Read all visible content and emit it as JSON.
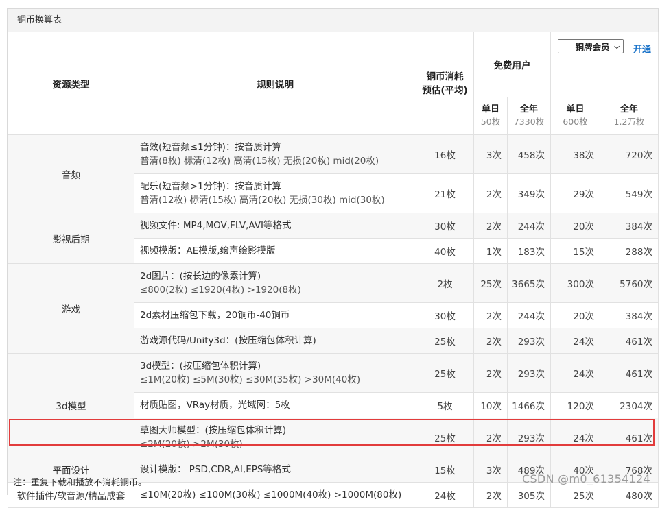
{
  "title": "铜币换算表",
  "header": {
    "resource_type": "资源类型",
    "rules": "规则说明",
    "cost_line1": "铜币消耗",
    "cost_line2": "预估(平均)",
    "free_user": "免费用户",
    "member_select": "铜牌会员",
    "open_link": "开通",
    "sub": [
      {
        "label": "单日",
        "value": "50枚"
      },
      {
        "label": "全年",
        "value": "7330枚"
      },
      {
        "label": "单日",
        "value": "600枚"
      },
      {
        "label": "全年",
        "value": "1.2万枚"
      }
    ]
  },
  "categories": {
    "audio": "音频",
    "video": "影视后期",
    "game": "游戏",
    "model3d": "3d模型",
    "graphic": "平面设计",
    "software": "软件插件/软音源/精品成套"
  },
  "rows": [
    {
      "rule": "音效(短音频≤1分钟)：按音质计算",
      "rule2": "普清(8枚)   标清(12枚)   高清(15枚)   无损(20枚)   mid(20枚)",
      "cost": "16枚",
      "c1": "3次",
      "c2": "458次",
      "c3": "38次",
      "c4": "720次"
    },
    {
      "rule": "配乐(短音频>1分钟)：按音质计算",
      "rule2": "普清(12枚)   标清(15枚)   高清(20枚)   无损(30枚)   mid(30枚)",
      "cost": "21枚",
      "c1": "2次",
      "c2": "349次",
      "c3": "29次",
      "c4": "549次"
    },
    {
      "rule": "视频文件: MP4,MOV,FLV,AVI等格式",
      "rule2": "",
      "cost": "30枚",
      "c1": "2次",
      "c2": "244次",
      "c3": "20次",
      "c4": "384次"
    },
    {
      "rule": "视频模版：AE模版,绘声绘影模版",
      "rule2": "",
      "cost": "40枚",
      "c1": "1次",
      "c2": "183次",
      "c3": "15次",
      "c4": "288次"
    },
    {
      "rule": "2d图片：(按长边的像素计算)",
      "rule2": "≤800(2枚)  ≤1920(4枚)  >1920(8枚)",
      "cost": "2枚",
      "c1": "25次",
      "c2": "3665次",
      "c3": "300次",
      "c4": "5760次"
    },
    {
      "rule": "2d素材压缩包下载，20铜币-40铜币",
      "rule2": "",
      "cost": "30枚",
      "c1": "2次",
      "c2": "244次",
      "c3": "20次",
      "c4": "384次"
    },
    {
      "rule": "游戏源代码/Unity3d：(按压缩包体积计算)",
      "rule2": "",
      "cost": "25枚",
      "c1": "2次",
      "c2": "293次",
      "c3": "24次",
      "c4": "461次"
    },
    {
      "rule": "3d模型：(按压缩包体积计算)",
      "rule2": "≤1M(20枚)  ≤5M(30枚)  ≤30M(35枚)  >30M(40枚)",
      "cost": "25枚",
      "c1": "2次",
      "c2": "293次",
      "c3": "24次",
      "c4": "461次"
    },
    {
      "rule": "材质贴图，VRay材质，光域网：5枚",
      "rule2": "",
      "cost": "5枚",
      "c1": "10次",
      "c2": "1466次",
      "c3": "120次",
      "c4": "2304次"
    },
    {
      "rule": "草图大师模型：(按压缩包体积计算)",
      "rule2": "≤2M(20枚)  >2M(30枚)",
      "cost": "25枚",
      "c1": "2次",
      "c2": "293次",
      "c3": "24次",
      "c4": "461次"
    },
    {
      "rule": "设计模版：  PSD,CDR,AI,EPS等格式",
      "rule2": "",
      "cost": "15枚",
      "c1": "3次",
      "c2": "489次",
      "c3": "40次",
      "c4": "768次"
    },
    {
      "rule": "≤10M(20枚)  ≤100M(30枚)  ≤1000M(40枚)  >1000M(80枚)",
      "rule2": "",
      "cost": "24枚",
      "c1": "2次",
      "c2": "305次",
      "c3": "25次",
      "c4": "480次"
    }
  ],
  "note": "注：重复下载和播放不消耗铜币。",
  "watermark": "CSDN @m0_61354124",
  "colors": {
    "highlight": "#e23c3c",
    "link": "#1a73c9"
  }
}
